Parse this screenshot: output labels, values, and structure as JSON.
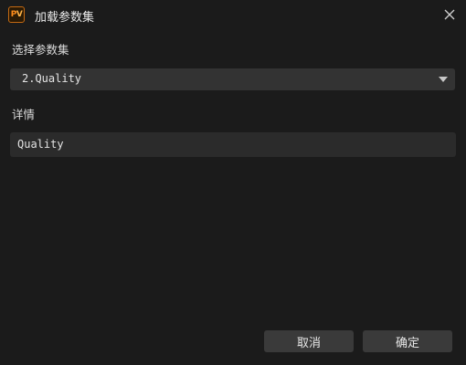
{
  "window": {
    "title": "加载参数集",
    "app_icon": {
      "letter_p": "P",
      "letter_v": "V",
      "name": "pv-app-icon"
    },
    "close_icon": "close-icon"
  },
  "form": {
    "select_label": "选择参数集",
    "selected_value": "2.Quality",
    "detail_label": "详情",
    "detail_value": "Quality"
  },
  "buttons": {
    "cancel_label": "取消",
    "ok_label": "确定"
  },
  "colors": {
    "background": "#1b1b1b",
    "dropdown_bg": "#333333",
    "field_bg": "#2b2b2b",
    "button_bg": "#3a3a3a",
    "icon_accent": "#ff8c1a"
  }
}
